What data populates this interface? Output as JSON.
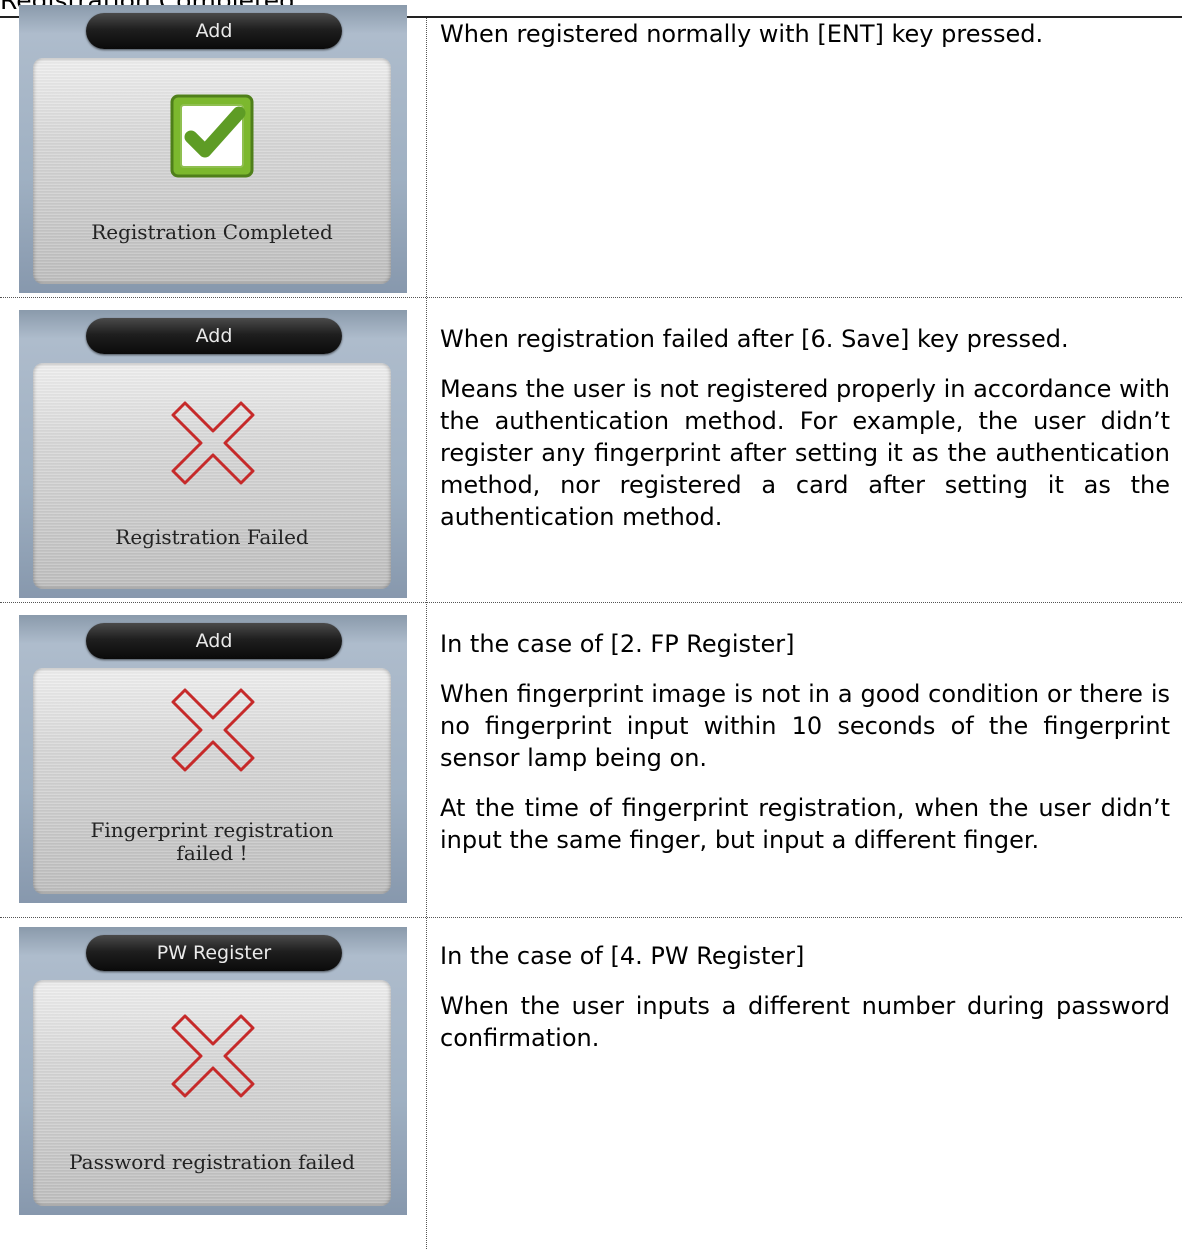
{
  "header": {
    "cut_text": "Registration Completed"
  },
  "rows": [
    {
      "screen": {
        "title": "Add",
        "icon": "check-icon",
        "message": "Registration Completed"
      },
      "description": [
        "When registered normally with [ENT] key pressed."
      ]
    },
    {
      "screen": {
        "title": "Add",
        "icon": "cross-icon",
        "message": "Registration Failed"
      },
      "description": [
        "When registration failed after [6. Save] key pressed.",
        "Means the user is not registered properly in accordance with the authentication method. For example, the user didn’t register any fingerprint after setting it as the authentication method, nor registered a card after setting it as the authentication method."
      ]
    },
    {
      "screen": {
        "title": "Add",
        "icon": "cross-icon",
        "message_line1": "Fingerprint registration",
        "message_line2": "failed !"
      },
      "description": [
        "In the case of [2. FP Register]",
        "When fingerprint image is not in a good condition or there is no fingerprint input within 10 seconds of the fingerprint sensor lamp being on.",
        "At the time of fingerprint registration, when the user didn’t input the same finger, but input a different finger."
      ]
    },
    {
      "screen": {
        "title": "PW Register",
        "icon": "cross-icon",
        "message": "Password registration failed"
      },
      "description": [
        "In the case of [4. PW Register]",
        "When the user inputs a different number during password confirmation."
      ]
    }
  ],
  "colors": {
    "check_green": "#6aa82a",
    "cross_red": "#c62a2a",
    "pill_dark": "#1f1f1f"
  }
}
